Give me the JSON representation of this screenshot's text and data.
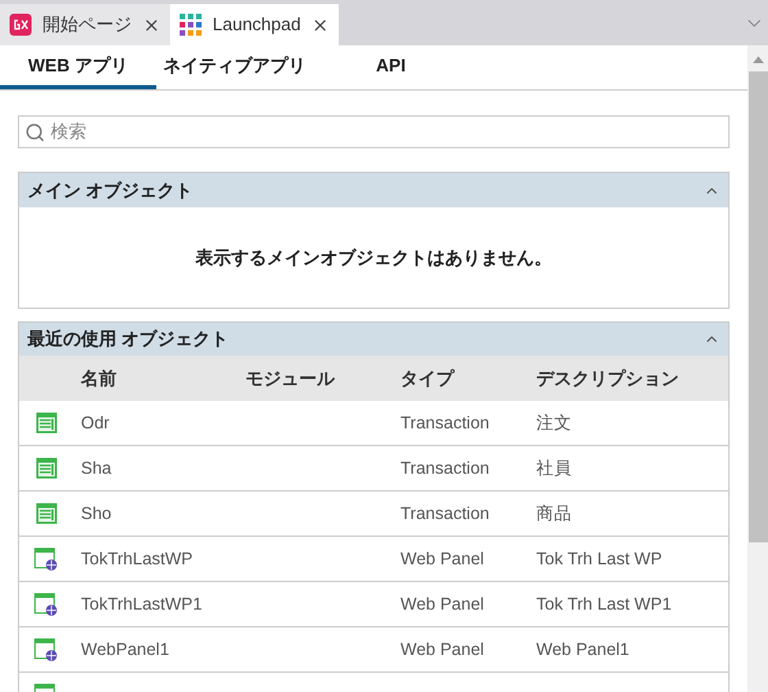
{
  "doc_tabs": [
    {
      "label": "開始ページ",
      "kind": "gx",
      "selected": false
    },
    {
      "label": "Launchpad",
      "kind": "grid",
      "selected": true
    }
  ],
  "sub_tabs": [
    {
      "label": "WEB アプリ",
      "selected": true
    },
    {
      "label": "ネイティブアプリ",
      "selected": false
    },
    {
      "label": "API",
      "selected": false
    }
  ],
  "search": {
    "placeholder": "検索"
  },
  "main_objects": {
    "title": "メイン オブジェクト",
    "expanded": true,
    "empty_message": "表示するメインオブジェクトはありません。"
  },
  "recent_objects": {
    "title": "最近の使用 オブジェクト",
    "expanded": true,
    "columns": [
      "名前",
      "モジュール",
      "タイプ",
      "デスクリプション"
    ],
    "rows": [
      {
        "kind": "transaction",
        "name": "Odr",
        "type": "Transaction",
        "description": "注文"
      },
      {
        "kind": "transaction",
        "name": "Sha",
        "type": "Transaction",
        "description": "社員"
      },
      {
        "kind": "transaction",
        "name": "Sho",
        "type": "Transaction",
        "description": "商品"
      },
      {
        "kind": "web_panel",
        "name": "TokTrhLastWP",
        "type": "Web Panel",
        "description": "Tok Trh Last WP"
      },
      {
        "kind": "web_panel",
        "name": "TokTrhLastWP1",
        "type": "Web Panel",
        "description": "Tok Trh Last WP1"
      },
      {
        "kind": "web_panel",
        "name": "WebPanel1",
        "type": "Web Panel",
        "description": "Web Panel1"
      },
      {
        "kind": "web_panel"
      }
    ]
  }
}
